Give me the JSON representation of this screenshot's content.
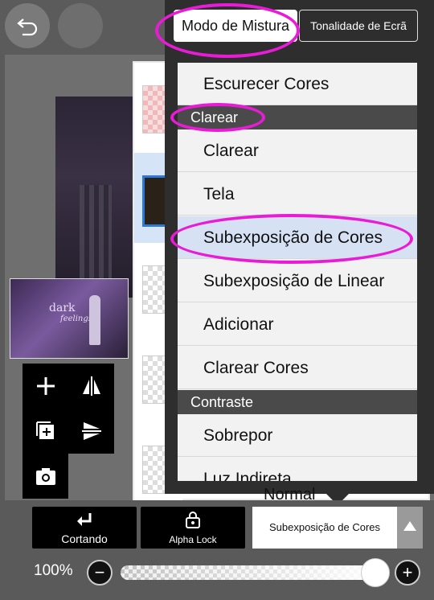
{
  "header": {
    "undo_icon": "undo-icon",
    "redo_icon": "redo-icon"
  },
  "blend_popup": {
    "tabs": [
      {
        "label": "Modo de Mistura",
        "active": true
      },
      {
        "label": "Tonalidade de Ecrã",
        "active": false
      }
    ],
    "items": [
      {
        "type": "item",
        "label": "Escurecer Cores"
      },
      {
        "type": "header",
        "label": "Clarear"
      },
      {
        "type": "item",
        "label": "Clarear"
      },
      {
        "type": "item",
        "label": "Tela"
      },
      {
        "type": "item",
        "label": "Subexposição de Cores",
        "selected": true
      },
      {
        "type": "item",
        "label": "Subexposição de Linear"
      },
      {
        "type": "item",
        "label": "Adicionar"
      },
      {
        "type": "item",
        "label": "Clarear Cores"
      },
      {
        "type": "header",
        "label": "Contraste"
      },
      {
        "type": "item",
        "label": "Sobrepor"
      },
      {
        "type": "item",
        "label": "Luz Indireta"
      }
    ],
    "peek_label": "Normal"
  },
  "tools": [
    "add-layer-icon",
    "flip-horizontal-icon",
    "duplicate-layer-icon",
    "flip-vertical-icon",
    "camera-icon"
  ],
  "thumbnail": {
    "line1": "dark",
    "line2": "feelings"
  },
  "bottom": {
    "crop_label": "Cortando",
    "alpha_lock_label": "Alpha Lock",
    "blend_mode_value": "Subexposição de Cores",
    "opacity_label": "100%",
    "opacity_value": 100,
    "minus": "−",
    "plus": "+"
  },
  "colors": {
    "annotation": "#e81bd6",
    "selected_row": "#d6e2f3",
    "popup_bg": "#2e2e2e"
  }
}
